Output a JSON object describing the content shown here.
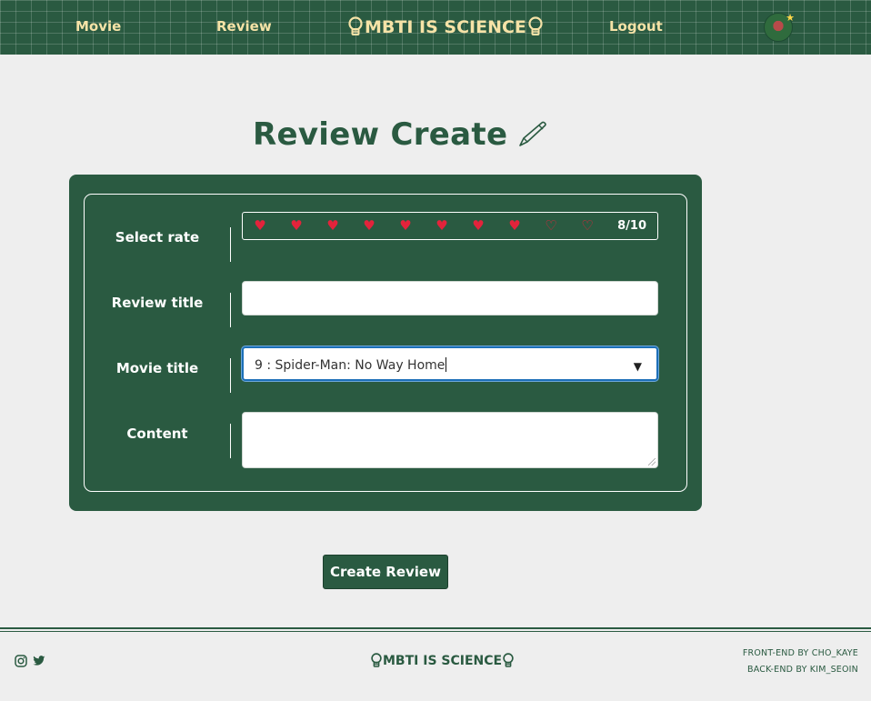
{
  "nav": {
    "movie_label": "Movie",
    "review_label": "Review",
    "brand": "MBTI IS SCIENCE",
    "logout_label": "Logout",
    "accent_color": "#f6e3a7",
    "background_color": "#2a5a41"
  },
  "page": {
    "title": "Review Create"
  },
  "form": {
    "rate_label": "Select rate",
    "rating": {
      "value": 8,
      "max": 10,
      "display": "8/10"
    },
    "review_title_label": "Review title",
    "review_title_value": "",
    "movie_title_label": "Movie title",
    "movie_title_selected": "9 : Spider-Man: No Way Home",
    "content_label": "Content",
    "content_value": ""
  },
  "submit_label": "Create Review",
  "footer": {
    "brand": "MBTI IS SCIENCE",
    "credit_front": "FRONT-END BY CHO_KAYE",
    "credit_back": "BACK-END BY KIM_SEOIN",
    "icons": [
      "instagram-icon",
      "twitter-icon"
    ]
  },
  "colors": {
    "heart": "#e3233b",
    "focus_ring": "#1d6fb8",
    "page_background": "#eeeeee"
  }
}
